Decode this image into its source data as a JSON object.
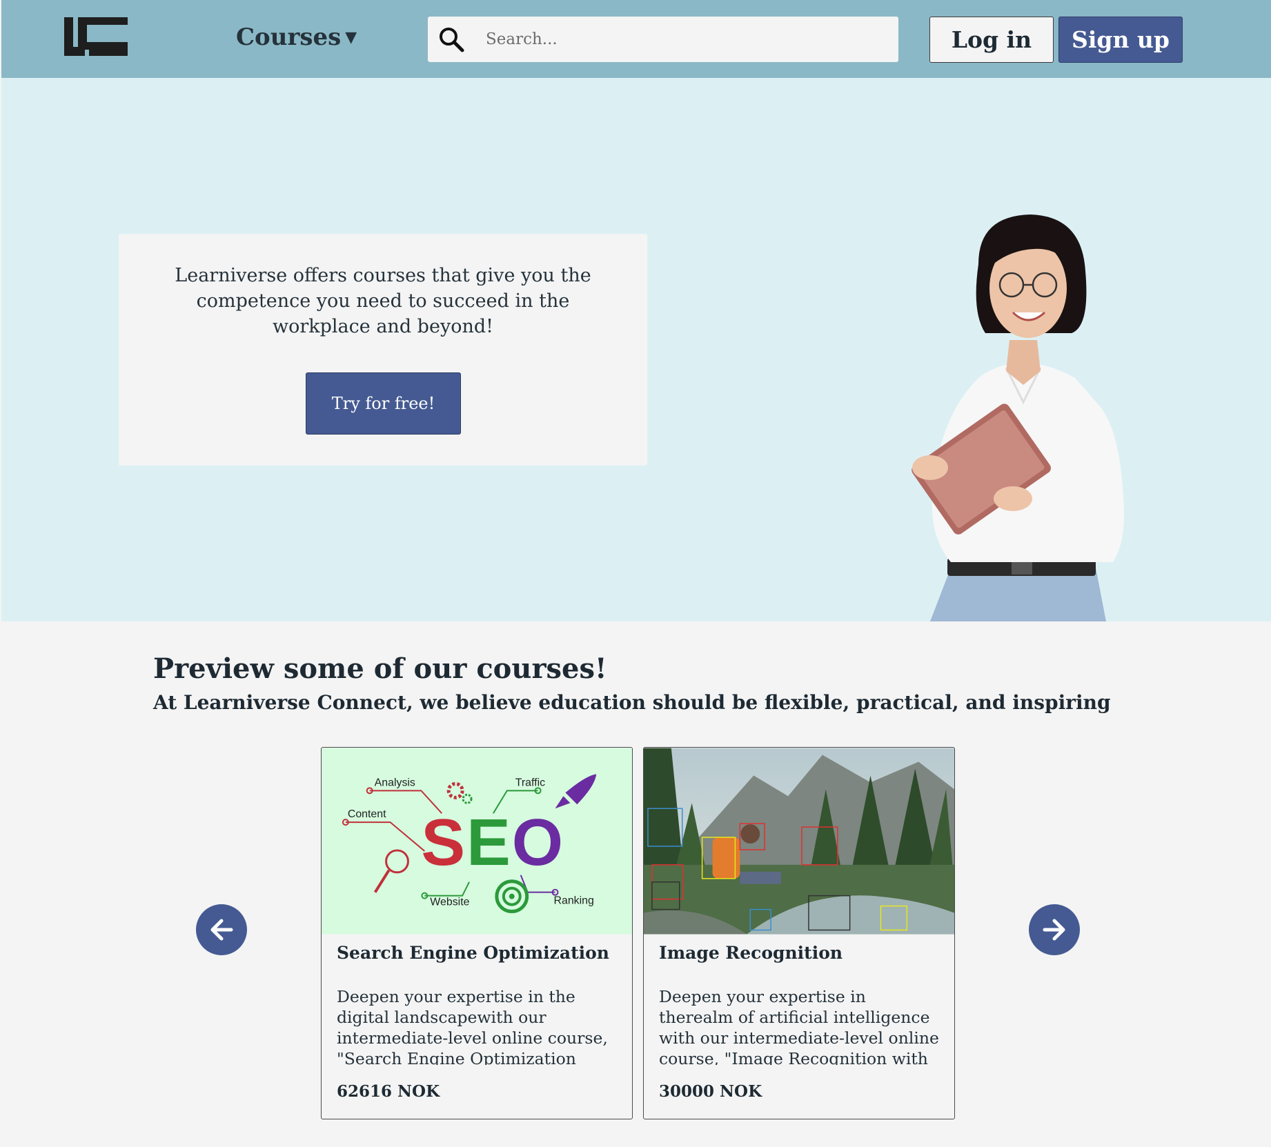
{
  "header": {
    "logo_text": "LC",
    "courses_label": "Courses",
    "search_placeholder": "Search...",
    "login_label": "Log in",
    "signup_label": "Sign up"
  },
  "hero": {
    "tagline": "Learniverse offers courses that give you the competence you need to succeed in the workplace and beyond!",
    "cta_label": "Try for free!"
  },
  "preview": {
    "title": "Preview some of our courses!",
    "subtitle": "At Learniverse Connect, we believe education should be flexible, practical, and inspiring",
    "courses": [
      {
        "title": "Search Engine Optimization",
        "description": "Deepen your expertise in the digital landscapewith our intermediate-level online course, \"Search Engine Optimization (SEO).\"",
        "price": "62616 NOK",
        "image_labels": [
          "Analysis",
          "Traffic",
          "Content",
          "Website",
          "Ranking",
          "SEO"
        ]
      },
      {
        "title": "Image Recognition",
        "description": "Deepen your expertise in therealm of artificial intelligence with our intermediate-level online course, \"Image Recognition with Python.\"",
        "price": "30000 NOK"
      }
    ]
  },
  "colors": {
    "header_bg": "#8ab8c6",
    "hero_bg": "#dcf0f4",
    "accent": "#455a92",
    "page_bg": "#f4f4f4"
  }
}
